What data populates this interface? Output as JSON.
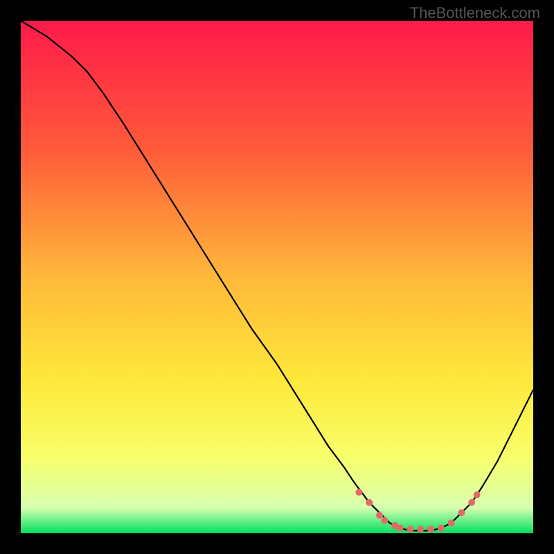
{
  "watermark": "TheBottleneck.com",
  "chart_data": {
    "type": "line",
    "title": "",
    "xlabel": "",
    "ylabel": "",
    "xlim": [
      0,
      100
    ],
    "ylim": [
      0,
      100
    ],
    "gradient_stops": [
      {
        "offset": 0,
        "color": "#ff1a4a"
      },
      {
        "offset": 25,
        "color": "#ff5a3a"
      },
      {
        "offset": 50,
        "color": "#ffb83a"
      },
      {
        "offset": 70,
        "color": "#ffe83a"
      },
      {
        "offset": 85,
        "color": "#f8ff6a"
      },
      {
        "offset": 95,
        "color": "#d8ffb0"
      },
      {
        "offset": 100,
        "color": "#00e060"
      }
    ],
    "series": [
      {
        "name": "bottleneck-curve",
        "color": "#000000",
        "x": [
          0,
          5,
          10,
          13,
          16,
          20,
          25,
          30,
          35,
          40,
          45,
          50,
          55,
          60,
          63,
          65,
          68,
          70,
          72,
          74,
          76,
          78,
          80,
          82,
          84,
          86,
          88,
          90,
          93,
          96,
          100
        ],
        "y": [
          100,
          97,
          93,
          90,
          86,
          80,
          72,
          64,
          56,
          48,
          40,
          33,
          25,
          17,
          13,
          10,
          6,
          4,
          2,
          1,
          0.5,
          0.5,
          0.5,
          1,
          2,
          4,
          6,
          9,
          14,
          20,
          28
        ]
      }
    ],
    "marker_points": {
      "name": "highlight-dots",
      "color": "#e46a6a",
      "radius": 5,
      "x": [
        66,
        68,
        70,
        71,
        73,
        74,
        76,
        78,
        80,
        82,
        84,
        86,
        88,
        89
      ],
      "y": [
        8,
        6,
        3.5,
        2.5,
        1.5,
        1,
        0.8,
        0.8,
        0.8,
        1,
        2,
        4,
        6,
        7.5
      ]
    }
  }
}
